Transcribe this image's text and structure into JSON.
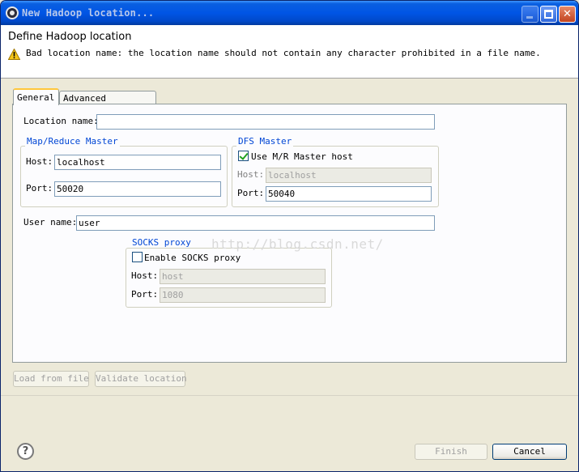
{
  "window": {
    "title": "New Hadoop location..."
  },
  "header": {
    "title": "Define Hadoop location",
    "message": "Bad location name: the location name should not contain any character prohibited in a file name."
  },
  "tabs": [
    {
      "label": "General",
      "selected": true
    },
    {
      "label": "Advanced parameters",
      "selected": false
    }
  ],
  "general": {
    "location_name_label": "Location name:",
    "location_name_value": "",
    "mr_master": {
      "title": "Map/Reduce Master",
      "host_label": "Host:",
      "host_value": "localhost",
      "port_label": "Port:",
      "port_value": "50020"
    },
    "dfs_master": {
      "title": "DFS Master",
      "use_mr_label": "Use M/R Master host",
      "use_mr_checked": true,
      "host_label": "Host:",
      "host_value": "localhost",
      "port_label": "Port:",
      "port_value": "50040"
    },
    "user_name_label": "User name:",
    "user_name_value": "user",
    "socks_proxy": {
      "title": "SOCKS proxy",
      "enable_label": "Enable SOCKS proxy",
      "enable_checked": false,
      "host_label": "Host:",
      "host_value": "host",
      "port_label": "Port:",
      "port_value": "1080"
    },
    "watermark": "http://blog.csdn.net/"
  },
  "actions": {
    "load_from_file": "Load from file",
    "validate_location": "Validate location"
  },
  "footer": {
    "finish": "Finish",
    "cancel": "Cancel"
  },
  "colors": {
    "titlebar": "#0055e5",
    "group_title": "#0046d5",
    "dialog_bg": "#ece9d8"
  }
}
